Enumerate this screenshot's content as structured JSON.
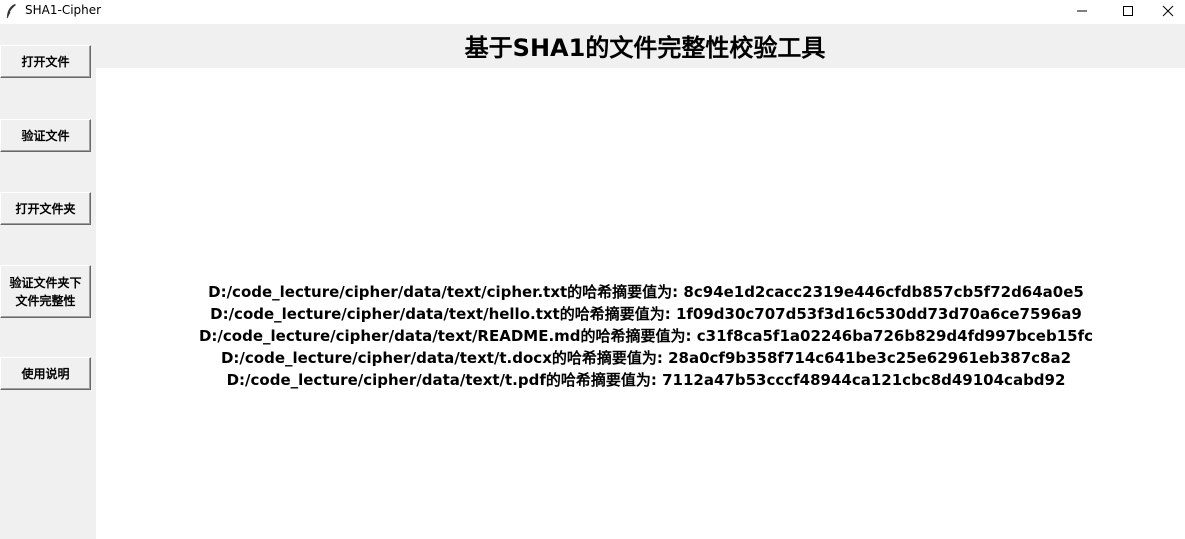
{
  "window": {
    "title": "SHA1-Cipher",
    "minimize_label": "",
    "maximize_label": "",
    "close_label": ""
  },
  "sidebar": {
    "buttons": [
      {
        "label": "打开文件"
      },
      {
        "label": "验证文件"
      },
      {
        "label": "打开文件夹"
      },
      {
        "label": "验证文件夹下\n文件完整性"
      },
      {
        "label": "使用说明"
      }
    ]
  },
  "main": {
    "title": "基于SHA1的文件完整性校验工具",
    "results": [
      "D:/code_lecture/cipher/data/text/cipher.txt的哈希摘要值为: 8c94e1d2cacc2319e446cfdb857cb5f72d64a0e5",
      "D:/code_lecture/cipher/data/text/hello.txt的哈希摘要值为: 1f09d30c707d53f3d16c530dd73d70a6ce7596a9",
      "D:/code_lecture/cipher/data/text/README.md的哈希摘要值为: c31f8ca5f1a02246ba726b829d4fd997bceb15fc",
      "D:/code_lecture/cipher/data/text/t.docx的哈希摘要值为: 28a0cf9b358f714c641be3c25e62961eb387c8a2",
      "D:/code_lecture/cipher/data/text/t.pdf的哈希摘要值为: 7112a47b53cccf48944ca121cbc8d49104cabd92"
    ]
  },
  "icons": {
    "app": "feather-icon",
    "minimize": "minimize-icon",
    "maximize": "maximize-icon",
    "close": "close-icon"
  },
  "colors": {
    "panel_bg": "#f0f0f0",
    "content_bg": "#ffffff",
    "text": "#000000"
  }
}
